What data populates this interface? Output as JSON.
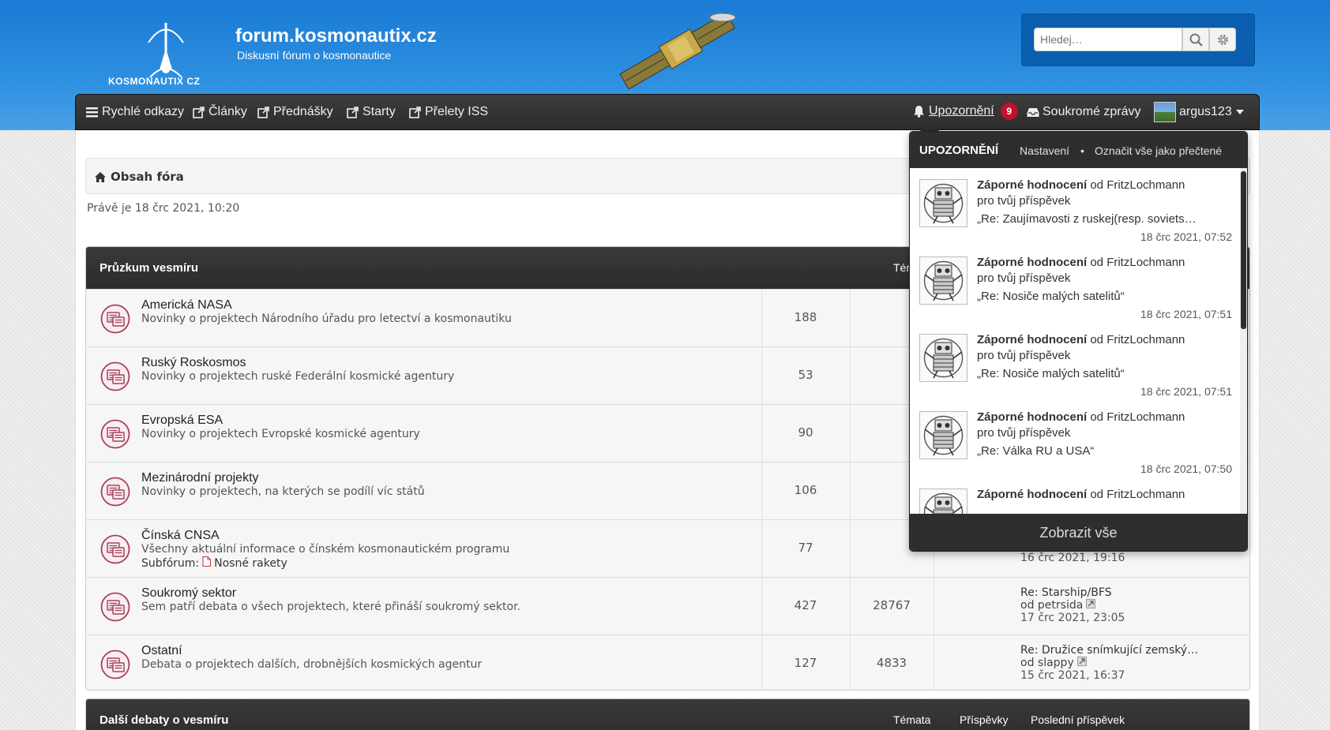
{
  "header": {
    "site_title": "forum.kosmonautix.cz",
    "site_description": "Diskusní fórum o kosmonautice",
    "logo_text": "KOSMONAUTIX CZ",
    "search_placeholder": "Hledej…"
  },
  "navbar": {
    "quick_links": "Rychlé odkazy",
    "articles": "Články",
    "lectures": "Přednášky",
    "launches": "Starty",
    "iss_passes": "Přelety ISS",
    "notifications": "Upozornění",
    "notifications_count": "9",
    "private_messages": "Soukromé zprávy",
    "username": "argus123"
  },
  "breadcrumb": {
    "home": "Obsah fóra"
  },
  "datetime": "Právě je 18 črc 2021, 10:20",
  "sections": [
    {
      "title": "Průzkum vesmíru",
      "col_topics": "Témata",
      "forums": [
        {
          "title": "Americká NASA",
          "desc": "Novinky o projektech Národního úřadu pro letectví a kosmonautiku",
          "topics": "188"
        },
        {
          "title": "Ruský Roskosmos",
          "desc": "Novinky o projektech ruské Federální kosmické agentury",
          "topics": "53"
        },
        {
          "title": "Evropská ESA",
          "desc": "Novinky o projektech Evropské kosmické agentury",
          "topics": "90"
        },
        {
          "title": "Mezinárodní projekty",
          "desc": "Novinky o projektech, na kterých se podílí víc států",
          "topics": "106"
        },
        {
          "title": "Čínská CNSA",
          "desc": "Všechny aktuální informace o čínském kosmonautickém programu",
          "topics": "77",
          "sub_label": "Subfórum:",
          "sub_link": "Nosné rakety",
          "last_date": "16 črc 2021, 19:16"
        },
        {
          "title": "Soukromý sektor",
          "desc": "Sem patří debata o všech projektech, které přináší soukromý sektor.",
          "topics": "427",
          "posts": "28767",
          "last_title": "Re: Starship/BFS",
          "last_by": "od petrsida",
          "last_date": "17 črc 2021, 23:05"
        },
        {
          "title": "Ostatní",
          "desc": "Debata o projektech dalších, drobnějších kosmických agentur",
          "topics": "127",
          "posts": "4833",
          "last_title": "Re: Družice snímkující zemský…",
          "last_by": "od slappy",
          "last_date": "15 črc 2021, 16:37"
        }
      ]
    },
    {
      "title": "Další debaty o vesmíru",
      "col_topics": "Témata",
      "col_posts": "Příspěvky",
      "col_last": "Poslední příspěvek"
    }
  ],
  "notifications": {
    "title": "UPOZORNĚNÍ",
    "settings": "Nastavení",
    "separator": "•",
    "mark_all": "Označit vše jako přečtené",
    "show_all": "Zobrazit vše",
    "items": [
      {
        "type": "Záporné hodnocení",
        "from": "od FritzLochmann",
        "target": "pro tvůj příspěvek",
        "quote": "„Re: Zaujímavosti z ruskej(resp. soviets…",
        "date": "18 črc 2021, 07:52"
      },
      {
        "type": "Záporné hodnocení",
        "from": "od FritzLochmann",
        "target": "pro tvůj příspěvek",
        "quote": "„Re: Nosiče malých satelitů“",
        "date": "18 črc 2021, 07:51"
      },
      {
        "type": "Záporné hodnocení",
        "from": "od FritzLochmann",
        "target": "pro tvůj příspěvek",
        "quote": "„Re: Nosiče malých satelitů“",
        "date": "18 črc 2021, 07:51"
      },
      {
        "type": "Záporné hodnocení",
        "from": "od FritzLochmann",
        "target": "pro tvůj příspěvek",
        "quote": "„Re: Válka RU a USA“",
        "date": "18 črc 2021, 07:50"
      },
      {
        "type": "Záporné hodnocení",
        "from": "od FritzLochmann"
      }
    ]
  }
}
